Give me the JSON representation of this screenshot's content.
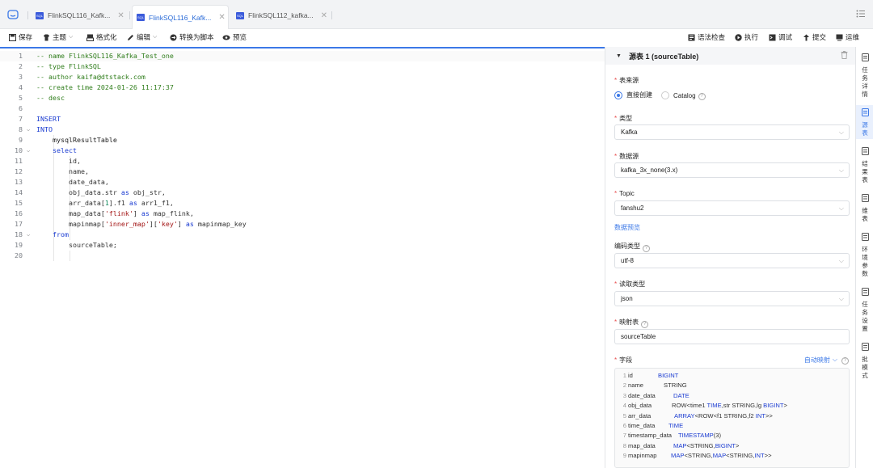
{
  "tabs": [
    {
      "label": "FlinkSQL116_Kafk...",
      "active": false
    },
    {
      "label": "FlinkSQL116_Kafk...",
      "active": true
    },
    {
      "label": "FlinkSQL112_kafka...",
      "active": false
    }
  ],
  "tab_badge": "SQL",
  "toolbar": {
    "save": "保存",
    "theme": "主题",
    "format": "格式化",
    "edit": "编辑",
    "convert": "转换为脚本",
    "preview": "预览",
    "syntax_check": "语法检查",
    "run": "执行",
    "debug": "调试",
    "submit": "提交",
    "ops": "运维"
  },
  "code": [
    {
      "n": "1",
      "html": "<span class=\"cm\">-- name FlinkSQL116_Kafka_Test_one</span>"
    },
    {
      "n": "2",
      "html": "<span class=\"cm\">-- type FlinkSQL</span>"
    },
    {
      "n": "3",
      "html": "<span class=\"cm\">-- author kaifa@dtstack.com</span>"
    },
    {
      "n": "4",
      "html": "<span class=\"cm\">-- create time 2024-01-26 11:17:37</span>"
    },
    {
      "n": "5",
      "html": "<span class=\"cm\">-- desc</span>"
    },
    {
      "n": "6",
      "html": ""
    },
    {
      "n": "7",
      "html": "<span class=\"kw\">INSERT</span>"
    },
    {
      "n": "8",
      "fold": true,
      "html": "<span class=\"kw\">INTO</span>"
    },
    {
      "n": "9",
      "html": "    <span class=\"idt\">mysqlResultTable</span>"
    },
    {
      "n": "10",
      "fold": true,
      "html": "    <span class=\"kw\">select</span>"
    },
    {
      "n": "11",
      "html": "        id,"
    },
    {
      "n": "12",
      "html": "        name,"
    },
    {
      "n": "13",
      "html": "        date_data,"
    },
    {
      "n": "14",
      "html": "        obj_data.str <span class=\"kw\">as</span> obj_str,"
    },
    {
      "n": "15",
      "html": "        arr_data[<span class=\"num\">1</span>].f1 <span class=\"kw\">as</span> arr1_f1,"
    },
    {
      "n": "16",
      "html": "        map_data[<span class=\"str\">'flink'</span>] <span class=\"kw\">as</span> map_flink,"
    },
    {
      "n": "17",
      "html": "        mapinmap[<span class=\"str\">'inner_map'</span>][<span class=\"str\">'key'</span>] <span class=\"kw\">as</span> mapinmap_key"
    },
    {
      "n": "18",
      "fold": true,
      "html": "    <span class=\"kw\">from</span>"
    },
    {
      "n": "19",
      "html": "        sourceTable;"
    },
    {
      "n": "20",
      "html": ""
    }
  ],
  "panel": {
    "title": "源表 1 (sourceTable)",
    "source_label": "表来源",
    "source_opt_direct": "直接创建",
    "source_opt_catalog": "Catalog",
    "type_label": "类型",
    "type_value": "Kafka",
    "datasource_label": "数据源",
    "datasource_value": "kafka_3x_none(3.x)",
    "topic_label": "Topic",
    "topic_value": "fanshu2",
    "data_preview": "数据预览",
    "encoding_label": "编码类型",
    "encoding_value": "utf-8",
    "read_type_label": "读取类型",
    "read_type_value": "json",
    "mapping_label": "映射表",
    "mapping_value": "sourceTable",
    "fields_label": "字段",
    "auto_map": "自动映射"
  },
  "fields": [
    {
      "n": "1",
      "name": "id",
      "type": "<span class=\"k\">BIGINT</span>"
    },
    {
      "n": "2",
      "name": "name",
      "type": "STRING"
    },
    {
      "n": "3",
      "name": "date_data",
      "type": "<span class=\"k\">DATE</span>"
    },
    {
      "n": "4",
      "name": "obj_data",
      "type": "ROW&lt;time1 <span class=\"k\">TIME</span>,str STRING,lg <span class=\"k\">BIGINT</span>&gt;"
    },
    {
      "n": "5",
      "name": "arr_data",
      "type": "<span class=\"k\">ARRAY</span>&lt;ROW&lt;f1 STRING,f2 <span class=\"k\">INT</span>&gt;&gt;"
    },
    {
      "n": "6",
      "name": "time_data",
      "type": "<span class=\"k\">TIME</span>"
    },
    {
      "n": "7",
      "name": "timestamp_data",
      "type": "<span class=\"k\">TIMESTAMP</span>(3)"
    },
    {
      "n": "8",
      "name": "map_data",
      "type": "<span class=\"k\">MAP</span>&lt;STRING,<span class=\"k\">BIGINT</span>&gt;"
    },
    {
      "n": "9",
      "name": "mapinmap",
      "type": "<span class=\"k\">MAP</span>&lt;STRING,<span class=\"k\">MAP</span>&lt;STRING,<span class=\"k\">INT</span>&gt;&gt;"
    }
  ],
  "rail": [
    {
      "label": "任务详情",
      "icon": "task-detail-icon",
      "active": false
    },
    {
      "label": "源表",
      "icon": "source-table-icon",
      "active": true
    },
    {
      "label": "结果表",
      "icon": "result-table-icon",
      "active": false
    },
    {
      "label": "维表",
      "icon": "dim-table-icon",
      "active": false
    },
    {
      "label": "环境参数",
      "icon": "env-params-icon",
      "active": false
    },
    {
      "label": "任务设置",
      "icon": "task-settings-icon",
      "active": false
    },
    {
      "label": "批模式",
      "icon": "batch-mode-icon",
      "active": false
    }
  ],
  "colors": {
    "accent": "#3b78e7",
    "required": "#e84a4a",
    "comment": "#2f7d1b",
    "keyword": "#1a3bd1",
    "string": "#a31515"
  }
}
